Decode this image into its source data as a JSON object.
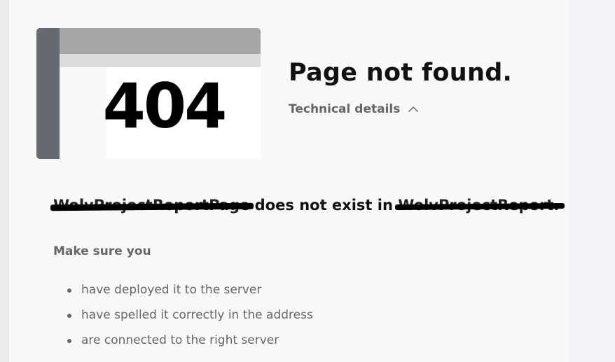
{
  "error": {
    "code": "404",
    "title": "Page not found.",
    "technical_details_label": "Technical details",
    "page_name": "WolvProjectReportPage",
    "message_middle": " does not exist in ",
    "app_name": "WolvProjectReport."
  },
  "help": {
    "heading": "Make sure you",
    "items": [
      "have deployed it to the server",
      "have spelled it correctly in the address",
      "are connected to the right server"
    ]
  },
  "icons": {
    "details_toggle": "chevron-up-icon"
  },
  "colors": {
    "illustration_side": "#646a70",
    "illustration_top": "#a6a6a6",
    "text_primary": "#111111",
    "text_muted": "#666666",
    "panel_background": "#f8f8f8"
  }
}
